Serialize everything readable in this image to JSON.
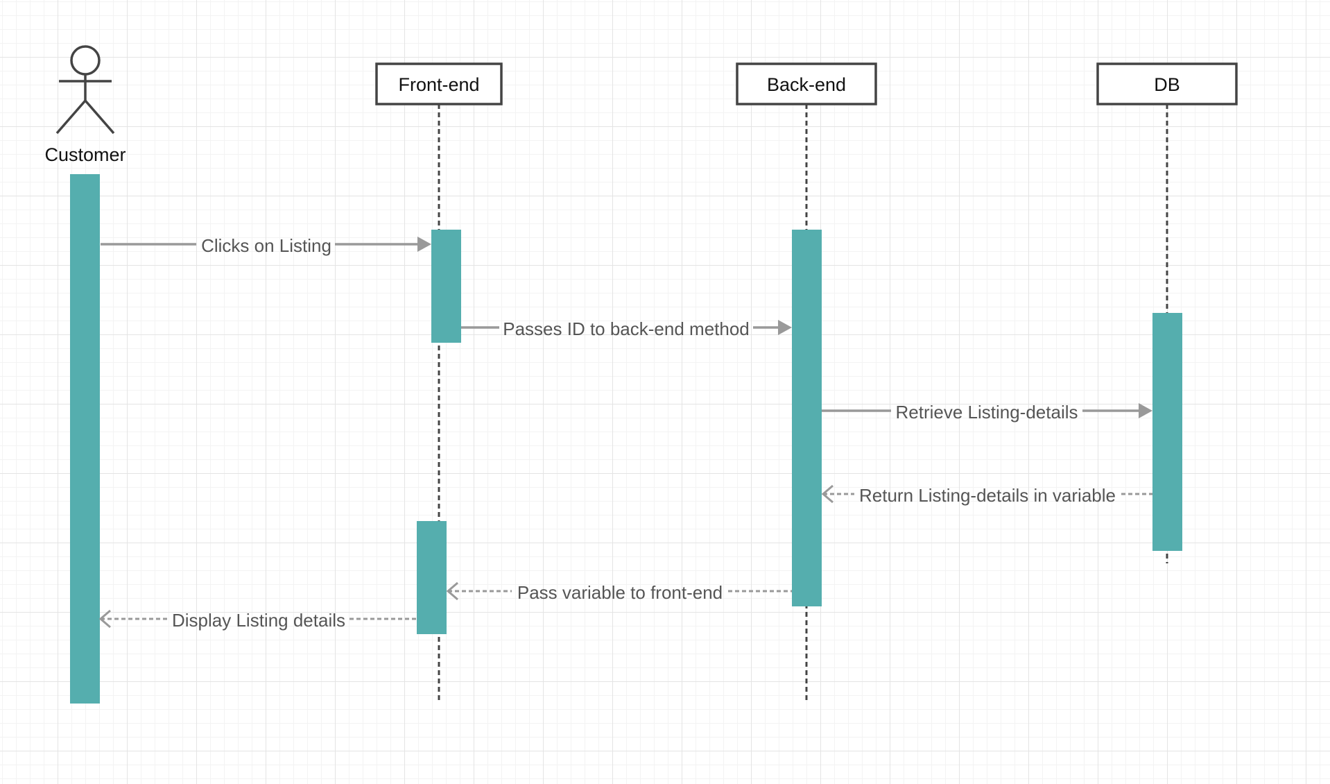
{
  "actor": {
    "name": "Customer"
  },
  "participants": [
    {
      "id": "frontend",
      "label": "Front-end"
    },
    {
      "id": "backend",
      "label": "Back-end"
    },
    {
      "id": "db",
      "label": "DB"
    }
  ],
  "messages": [
    {
      "label": "Clicks on Listing",
      "from": "actor",
      "to": "frontend",
      "kind": "call"
    },
    {
      "label": "Passes ID to back-end method",
      "from": "frontend",
      "to": "backend",
      "kind": "call"
    },
    {
      "label": "Retrieve Listing-details",
      "from": "backend",
      "to": "db",
      "kind": "call"
    },
    {
      "label": "Return Listing-details in variable",
      "from": "db",
      "to": "backend",
      "kind": "return"
    },
    {
      "label": "Pass variable to front-end",
      "from": "backend",
      "to": "frontend",
      "kind": "return"
    },
    {
      "label": "Display Listing details",
      "from": "frontend",
      "to": "actor",
      "kind": "return"
    }
  ],
  "colors": {
    "activation": "#55aeae",
    "box_border": "#444444",
    "lifeline": "#444444",
    "message_line": "#999999",
    "message_text": "#555555"
  }
}
